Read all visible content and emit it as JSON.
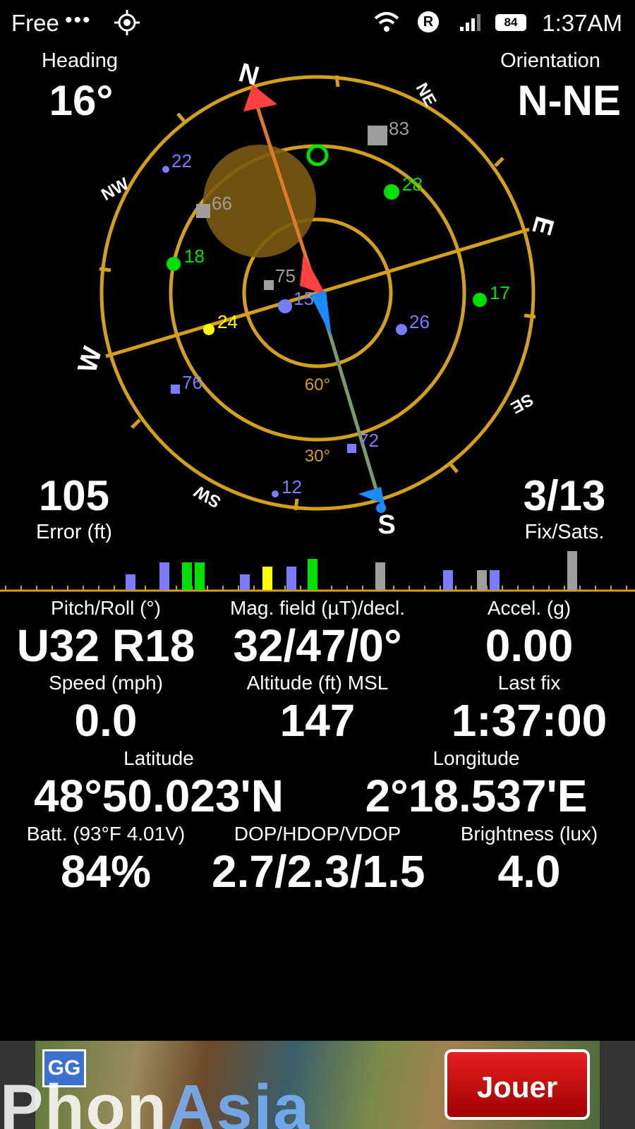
{
  "status_bar": {
    "carrier": "Free",
    "dots": "•••",
    "battery_level": "84",
    "roaming_badge": "R",
    "time": "1:37AM",
    "icons": [
      "gps-icon",
      "wifi-icon",
      "roaming-icon",
      "signal-icon",
      "battery-icon"
    ]
  },
  "heading": {
    "label": "Heading",
    "value": "16°"
  },
  "orientation": {
    "label": "Orientation",
    "value": "N-NE"
  },
  "error": {
    "value": "105",
    "label": "Error (ft)"
  },
  "fix": {
    "value": "3/13",
    "label": "Fix/Sats."
  },
  "compass": {
    "directions": {
      "n": "N",
      "ne": "NE",
      "e": "E",
      "se": "SE",
      "s": "S",
      "sw": "SW",
      "w": "W",
      "nw": "NW"
    },
    "elevation_labels": [
      "60°",
      "30°"
    ],
    "heading_degrees": 16,
    "ring_color": "#d4a017",
    "satellites": [
      {
        "id": "83",
        "shape": "square",
        "color": "#9e9e9e"
      },
      {
        "id": "22",
        "shape": "dot",
        "color": "#7b7bff"
      },
      {
        "id": "28",
        "shape": "dot",
        "color": "#00e000"
      },
      {
        "id": "66",
        "shape": "square",
        "color": "#9e9e9e"
      },
      {
        "id": "18",
        "shape": "dot",
        "color": "#00e000"
      },
      {
        "id": "75",
        "shape": "square",
        "color": "#9e9e9e"
      },
      {
        "id": "15",
        "shape": "dot",
        "color": "#7b7bff"
      },
      {
        "id": "17",
        "shape": "dot",
        "color": "#00e000"
      },
      {
        "id": "24",
        "shape": "dot",
        "color": "#ffff00"
      },
      {
        "id": "26",
        "shape": "dot",
        "color": "#7b7bff"
      },
      {
        "id": "76",
        "shape": "square",
        "color": "#7b7bff"
      },
      {
        "id": "72",
        "shape": "square",
        "color": "#7b7bff"
      },
      {
        "id": "12",
        "shape": "dot",
        "color": "#7b7bff"
      }
    ]
  },
  "signal_bars": [
    {
      "color": "#7b7bff",
      "level": 0.4
    },
    {
      "color": "#7b7bff",
      "level": 0.7
    },
    {
      "color": "#00e000",
      "level": 0.7
    },
    {
      "color": "#00e000",
      "level": 0.7
    },
    {
      "color": "#7b7bff",
      "level": 0.4
    },
    {
      "color": "#ffff00",
      "level": 0.6
    },
    {
      "color": "#7b7bff",
      "level": 0.6
    },
    {
      "color": "#00e000",
      "level": 0.8
    },
    {
      "color": "#9e9e9e",
      "level": 0.7
    },
    {
      "color": "#7b7bff",
      "level": 0.5
    },
    {
      "color": "#9e9e9e",
      "level": 0.5
    },
    {
      "color": "#7b7bff",
      "level": 0.5
    },
    {
      "color": "#9e9e9e",
      "level": 1.0
    }
  ],
  "readings": {
    "pitch_roll": {
      "label": "Pitch/Roll (°)",
      "value": "U32 R18"
    },
    "mag_field": {
      "label": "Mag. field (µT)/decl.",
      "value": "32/47/0°"
    },
    "accel": {
      "label": "Accel. (g)",
      "value": "0.00"
    },
    "speed": {
      "label": "Speed (mph)",
      "value": "0.0"
    },
    "altitude": {
      "label": "Altitude (ft) MSL",
      "value": "147"
    },
    "last_fix": {
      "label": "Last fix",
      "value": "1:37:00"
    },
    "latitude": {
      "label": "Latitude",
      "value": "48°50.023'N"
    },
    "longitude": {
      "label": "Longitude",
      "value": "2°18.537'E"
    },
    "battery": {
      "label": "Batt. (93°F 4.01V)",
      "value": "84%"
    },
    "dop": {
      "label": "DOP/HDOP/VDOP",
      "value": "2.7/2.3/1.5"
    },
    "brightness": {
      "label": "Brightness (lux)",
      "value": "4.0"
    }
  },
  "ad": {
    "logo_text": "GG",
    "brand_part1": "Phon",
    "brand_part2": "Asia",
    "cta_label": "Jouer"
  }
}
